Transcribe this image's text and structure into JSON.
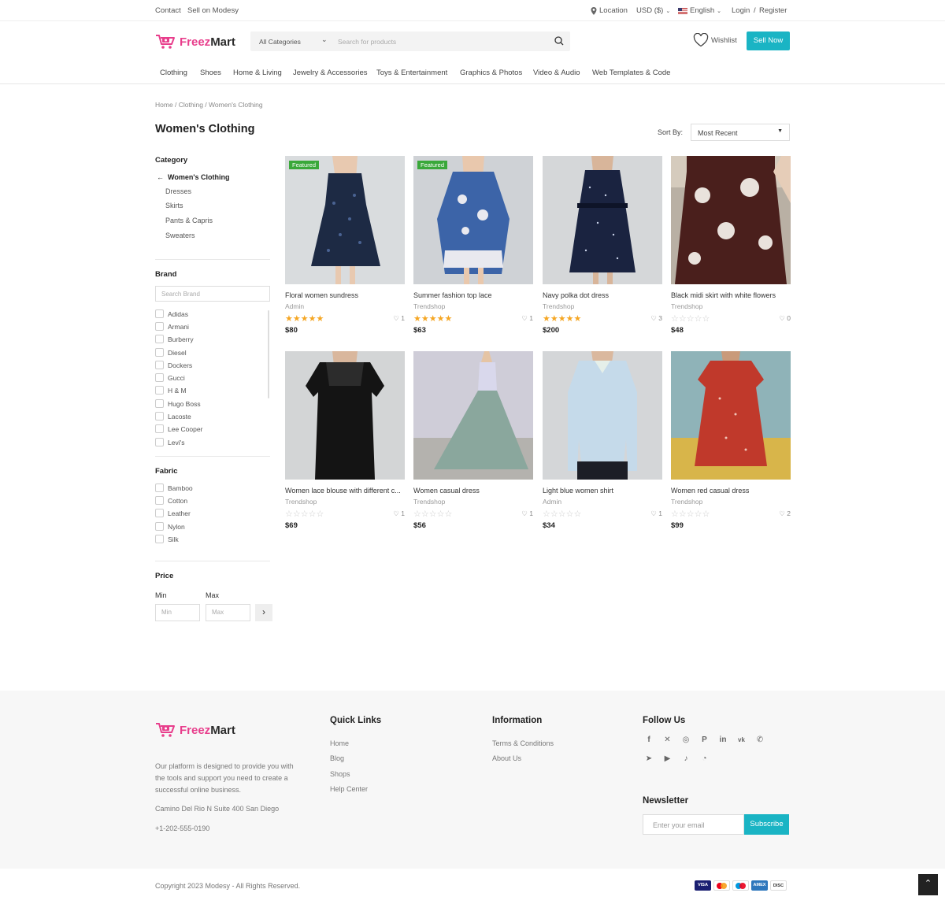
{
  "topbar": {
    "contact": "Contact",
    "sell": "Sell on Modesy",
    "location": "Location",
    "currency": "USD ($)",
    "language": "English",
    "login": "Login",
    "sep": "/",
    "register": "Register"
  },
  "header": {
    "logo_a": "Freez",
    "logo_b": "Mart",
    "category_select": "All Categories",
    "search_placeholder": "Search for products",
    "wishlist": "Wishlist",
    "sell_now": "Sell Now"
  },
  "nav": [
    "Clothing",
    "Shoes",
    "Home & Living",
    "Jewelry & Accessories",
    "Toys & Entertainment",
    "Graphics & Photos",
    "Video & Audio",
    "Web Templates & Code"
  ],
  "breadcrumb": "Home / Clothing / Women's Clothing",
  "page_title": "Women's Clothing",
  "sort": {
    "label": "Sort By:",
    "value": "Most Recent"
  },
  "sidebar": {
    "category_heading": "Category",
    "current": "Women's Clothing",
    "subcategories": [
      "Dresses",
      "Skirts",
      "Pants & Capris",
      "Sweaters"
    ],
    "brand_heading": "Brand",
    "brand_search_placeholder": "Search Brand",
    "brands": [
      "Adidas",
      "Armani",
      "Burberry",
      "Diesel",
      "Dockers",
      "Gucci",
      "H & M",
      "Hugo Boss",
      "Lacoste",
      "Lee Cooper",
      "Levi's"
    ],
    "fabric_heading": "Fabric",
    "fabrics": [
      "Bamboo",
      "Cotton",
      "Leather",
      "Nylon",
      "Silk"
    ],
    "price_heading": "Price",
    "min_label": "Min",
    "max_label": "Max",
    "min_placeholder": "Min",
    "max_placeholder": "Max"
  },
  "products": [
    {
      "name": "Floral women sundress",
      "seller": "Admin",
      "stars": 5,
      "likes": "1",
      "price": "$80",
      "featured": "Featured"
    },
    {
      "name": "Summer fashion top lace",
      "seller": "Trendshop",
      "stars": 5,
      "likes": "1",
      "price": "$63",
      "featured": "Featured"
    },
    {
      "name": "Navy polka dot dress",
      "seller": "Trendshop",
      "stars": 5,
      "likes": "3",
      "price": "$200",
      "featured": ""
    },
    {
      "name": "Black midi skirt with white flowers",
      "seller": "Trendshop",
      "stars": 0,
      "likes": "0",
      "price": "$48",
      "featured": ""
    },
    {
      "name": "Women lace blouse with different c...",
      "seller": "Trendshop",
      "stars": 0,
      "likes": "1",
      "price": "$69",
      "featured": ""
    },
    {
      "name": "Women casual dress",
      "seller": "Trendshop",
      "stars": 0,
      "likes": "1",
      "price": "$56",
      "featured": ""
    },
    {
      "name": "Light blue women shirt",
      "seller": "Admin",
      "stars": 0,
      "likes": "1",
      "price": "$34",
      "featured": ""
    },
    {
      "name": "Women red casual dress",
      "seller": "Trendshop",
      "stars": 0,
      "likes": "2",
      "price": "$99",
      "featured": ""
    }
  ],
  "footer": {
    "about": [
      "Our platform is designed to provide you with",
      "the tools and support you need to create a",
      "successful online business."
    ],
    "address": "Camino Del Rio N Suite 400 San Diego",
    "phone": "+1-202-555-0190",
    "quick_links_heading": "Quick Links",
    "quick_links": [
      "Home",
      "Blog",
      "Shops",
      "Help Center"
    ],
    "information_heading": "Information",
    "information": [
      "Terms & Conditions",
      "About Us"
    ],
    "follow_heading": "Follow Us",
    "social_icons": [
      "facebook-icon",
      "x-icon",
      "instagram-icon",
      "pinterest-icon",
      "linkedin-icon",
      "vk-icon",
      "whatsapp-icon",
      "telegram-icon",
      "youtube-icon",
      "tiktok-icon",
      "rss-icon"
    ],
    "newsletter_heading": "Newsletter",
    "email_placeholder": "Enter your email",
    "subscribe": "Subscribe",
    "copyright": "Copyright 2023 Modesy - All Rights Reserved.",
    "payment_icons": [
      "visa-icon",
      "mastercard-icon",
      "maestro-icon",
      "amex-icon",
      "discover-icon"
    ]
  },
  "colors": {
    "accent": "#1ab4c4",
    "brand": "#e83e8c",
    "featured": "#3aa83a",
    "star": "#f5a623"
  }
}
